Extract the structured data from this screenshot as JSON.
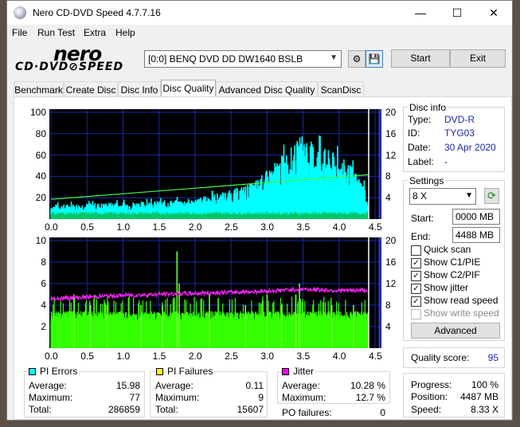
{
  "window": {
    "title": "Nero CD-DVD Speed 4.7.7.16"
  },
  "menu": [
    "File",
    "Run Test",
    "Extra",
    "Help"
  ],
  "logo": {
    "line1": "nero",
    "line2": "CD·DVD⊘SPEED"
  },
  "drive": {
    "selected": "[0:0]   BENQ DVD DD DW1640 BSLB"
  },
  "buttons": {
    "start": "Start",
    "exit": "Exit",
    "advanced": "Advanced"
  },
  "tabs": [
    "Benchmark",
    "Create Disc",
    "Disc Info",
    "Disc Quality",
    "Advanced Disc Quality",
    "ScanDisc"
  ],
  "active_tab": "Disc Quality",
  "disc_info": {
    "title": "Disc info",
    "type_label": "Type:",
    "type": "DVD-R",
    "id_label": "ID:",
    "id": "TYG03",
    "date_label": "Date:",
    "date": "30 Apr 2020",
    "label_label": "Label:",
    "label": "-"
  },
  "settings": {
    "title": "Settings",
    "speed": "8 X",
    "start_label": "Start:",
    "start": "0000 MB",
    "end_label": "End:",
    "end": "4488 MB",
    "quick_scan": "Quick scan",
    "show_c1pie": "Show C1/PIE",
    "show_c2pif": "Show C2/PIF",
    "show_jitter": "Show jitter",
    "show_read_speed": "Show read speed",
    "show_write_speed": "Show write speed",
    "checked": {
      "quick_scan": false,
      "show_c1pie": true,
      "show_c2pif": true,
      "show_jitter": true,
      "show_read_speed": true,
      "show_write_speed": false
    }
  },
  "quality": {
    "label": "Quality score:",
    "value": "95"
  },
  "progress": {
    "progress_label": "Progress:",
    "progress": "100 %",
    "position_label": "Position:",
    "position": "4487 MB",
    "speed_label": "Speed:",
    "speed": "8.33 X"
  },
  "stats": {
    "pi_errors": {
      "title": "PI Errors",
      "color": "#00ffff",
      "avg_label": "Average:",
      "avg": "15.98",
      "max_label": "Maximum:",
      "max": "77",
      "total_label": "Total:",
      "total": "286859"
    },
    "pi_failures": {
      "title": "PI Failures",
      "color": "#ffff00",
      "avg_label": "Average:",
      "avg": "0.11",
      "max_label": "Maximum:",
      "max": "9",
      "total_label": "Total:",
      "total": "15607"
    },
    "jitter": {
      "title": "Jitter",
      "color": "#ff00ff",
      "avg_label": "Average:",
      "avg": "10.28 %",
      "max_label": "Maximum:",
      "max": "12.7 %",
      "po_label": "PO failures:",
      "po": "0"
    }
  },
  "chart_data": [
    {
      "type": "area",
      "name": "pi_errors",
      "x_ticks": [
        "0.0",
        "0.5",
        "1.0",
        "1.5",
        "2.0",
        "2.5",
        "3.0",
        "3.5",
        "4.0",
        "4.5"
      ],
      "y_left_ticks": [
        "100",
        "80",
        "60",
        "40",
        "20"
      ],
      "y_right_ticks": [
        "20",
        "16",
        "12",
        "8",
        "4"
      ],
      "xlim": [
        0,
        4.5
      ],
      "ylim": [
        0,
        100
      ],
      "y2lim": [
        0,
        20
      ],
      "grid": true,
      "pie_envelope": {
        "x": [
          0.0,
          0.5,
          1.0,
          1.5,
          2.0,
          2.5,
          2.8,
          3.0,
          3.2,
          3.4,
          3.5,
          3.6,
          3.8,
          4.0,
          4.2,
          4.35,
          4.4
        ],
        "y": [
          12,
          13,
          14,
          15,
          17,
          24,
          30,
          40,
          52,
          62,
          72,
          64,
          58,
          52,
          42,
          28,
          14
        ]
      },
      "read_speed": {
        "x": [
          0.0,
          4.4
        ],
        "y": [
          3.7,
          8.3
        ]
      }
    },
    {
      "type": "bar",
      "name": "pi_failures",
      "x_ticks": [
        "0.0",
        "0.5",
        "1.0",
        "1.5",
        "2.0",
        "2.5",
        "3.0",
        "3.5",
        "4.0",
        "4.5"
      ],
      "y_left_ticks": [
        "10",
        "8",
        "6",
        "4",
        "2"
      ],
      "y_right_ticks": [
        "20",
        "16",
        "12",
        "8",
        "4"
      ],
      "xlim": [
        0,
        4.5
      ],
      "ylim": [
        0,
        10
      ],
      "y2lim": [
        0,
        20
      ],
      "grid": true,
      "pif_base": 3,
      "pif_spikes": {
        "x": [
          0.32,
          0.55,
          0.78,
          1.25,
          1.55,
          1.75,
          1.78,
          2.2,
          2.7,
          3.0,
          3.2,
          3.4,
          3.45,
          3.9,
          4.2
        ],
        "y": [
          5,
          4,
          4,
          4,
          4,
          9,
          6,
          5,
          4,
          5,
          4,
          5,
          6,
          4,
          4
        ]
      },
      "jitter": {
        "x": [
          0.0,
          0.5,
          1.0,
          1.5,
          2.0,
          2.5,
          3.0,
          3.5,
          3.8,
          4.0,
          4.4
        ],
        "y": [
          9.2,
          9.5,
          9.8,
          10.0,
          10.2,
          10.4,
          10.6,
          11.0,
          10.8,
          10.7,
          10.8
        ]
      }
    }
  ]
}
